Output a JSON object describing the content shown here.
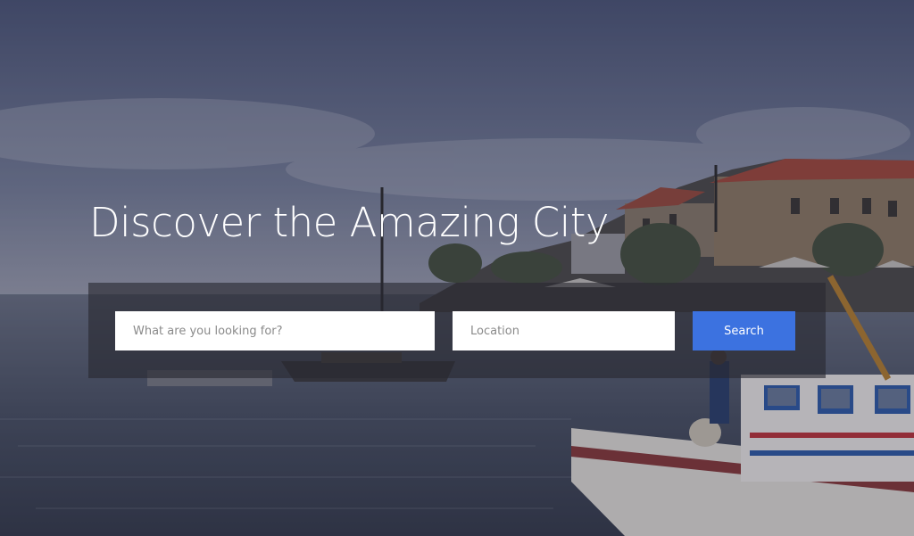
{
  "hero": {
    "headline": "Discover the Amazing City"
  },
  "search": {
    "keyword_placeholder": "What are you looking for?",
    "keyword_value": "",
    "location_placeholder": "Location",
    "location_value": "",
    "button_label": "Search"
  },
  "colors": {
    "accent": "#3c72e0",
    "panel": "#28283a",
    "text_light": "#ffffff"
  }
}
